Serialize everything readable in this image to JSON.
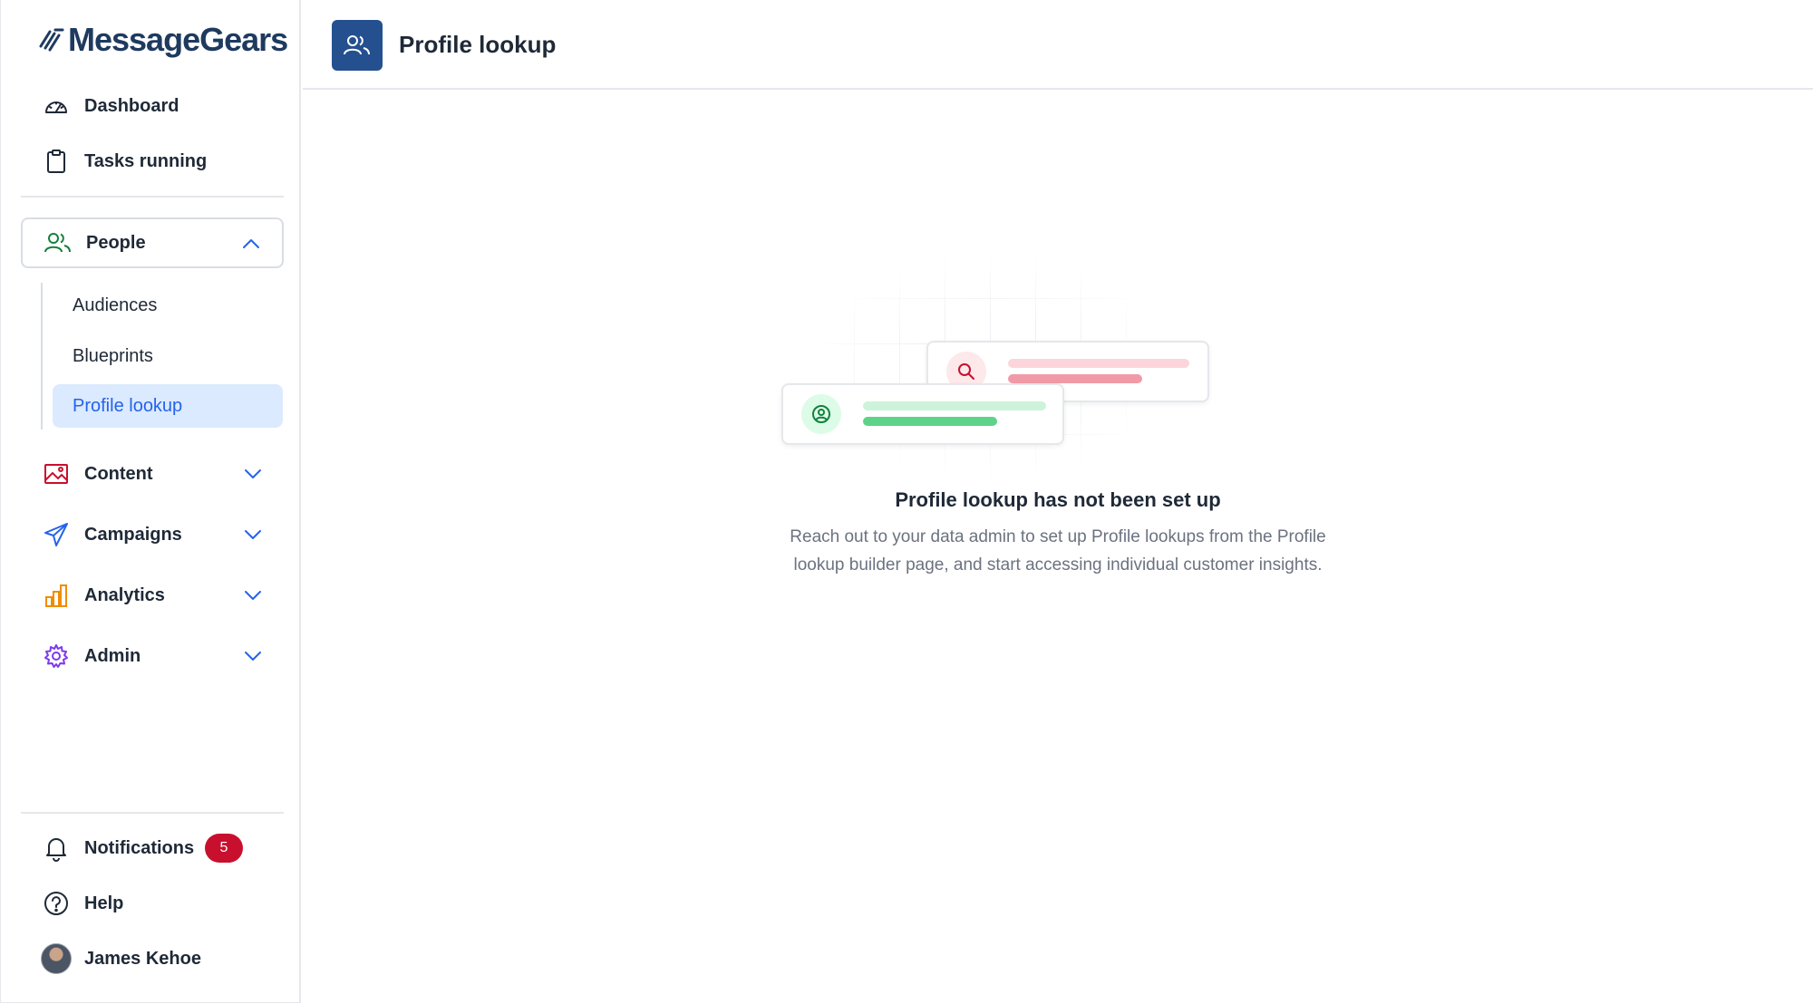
{
  "brand": {
    "name": "MessageGears"
  },
  "header": {
    "title": "Profile lookup",
    "icon": "people-icon"
  },
  "sidebar": {
    "top_items": [
      {
        "label": "Dashboard",
        "icon": "gauge-icon"
      },
      {
        "label": "Tasks running",
        "icon": "clipboard-icon"
      }
    ],
    "people": {
      "label": "People",
      "icon": "people-icon",
      "expanded": true,
      "sub_items": [
        {
          "label": "Audiences",
          "active": false
        },
        {
          "label": "Blueprints",
          "active": false
        },
        {
          "label": "Profile lookup",
          "active": true
        }
      ]
    },
    "sections": [
      {
        "label": "Content",
        "icon": "image-icon",
        "color": "#c8102e"
      },
      {
        "label": "Campaigns",
        "icon": "paper-plane-icon",
        "color": "#2563eb"
      },
      {
        "label": "Analytics",
        "icon": "bar-chart-icon",
        "color": "#f08c00"
      },
      {
        "label": "Admin",
        "icon": "gear-icon",
        "color": "#7c3aed"
      }
    ],
    "bottom_items": [
      {
        "label": "Notifications",
        "icon": "bell-icon",
        "badge": "5"
      },
      {
        "label": "Help",
        "icon": "question-icon"
      },
      {
        "label": "James Kehoe",
        "icon": "avatar"
      }
    ]
  },
  "empty_state": {
    "title": "Profile lookup has not been set up",
    "description": "Reach out to your data admin to set up Profile lookups from the Profile lookup builder page, and start accessing individual customer insights."
  },
  "colors": {
    "accent": "#2563eb",
    "header_icon_bg": "#24508f",
    "active_bg": "#dbeafe",
    "badge": "#c8102e",
    "people_green": "#15803d"
  }
}
